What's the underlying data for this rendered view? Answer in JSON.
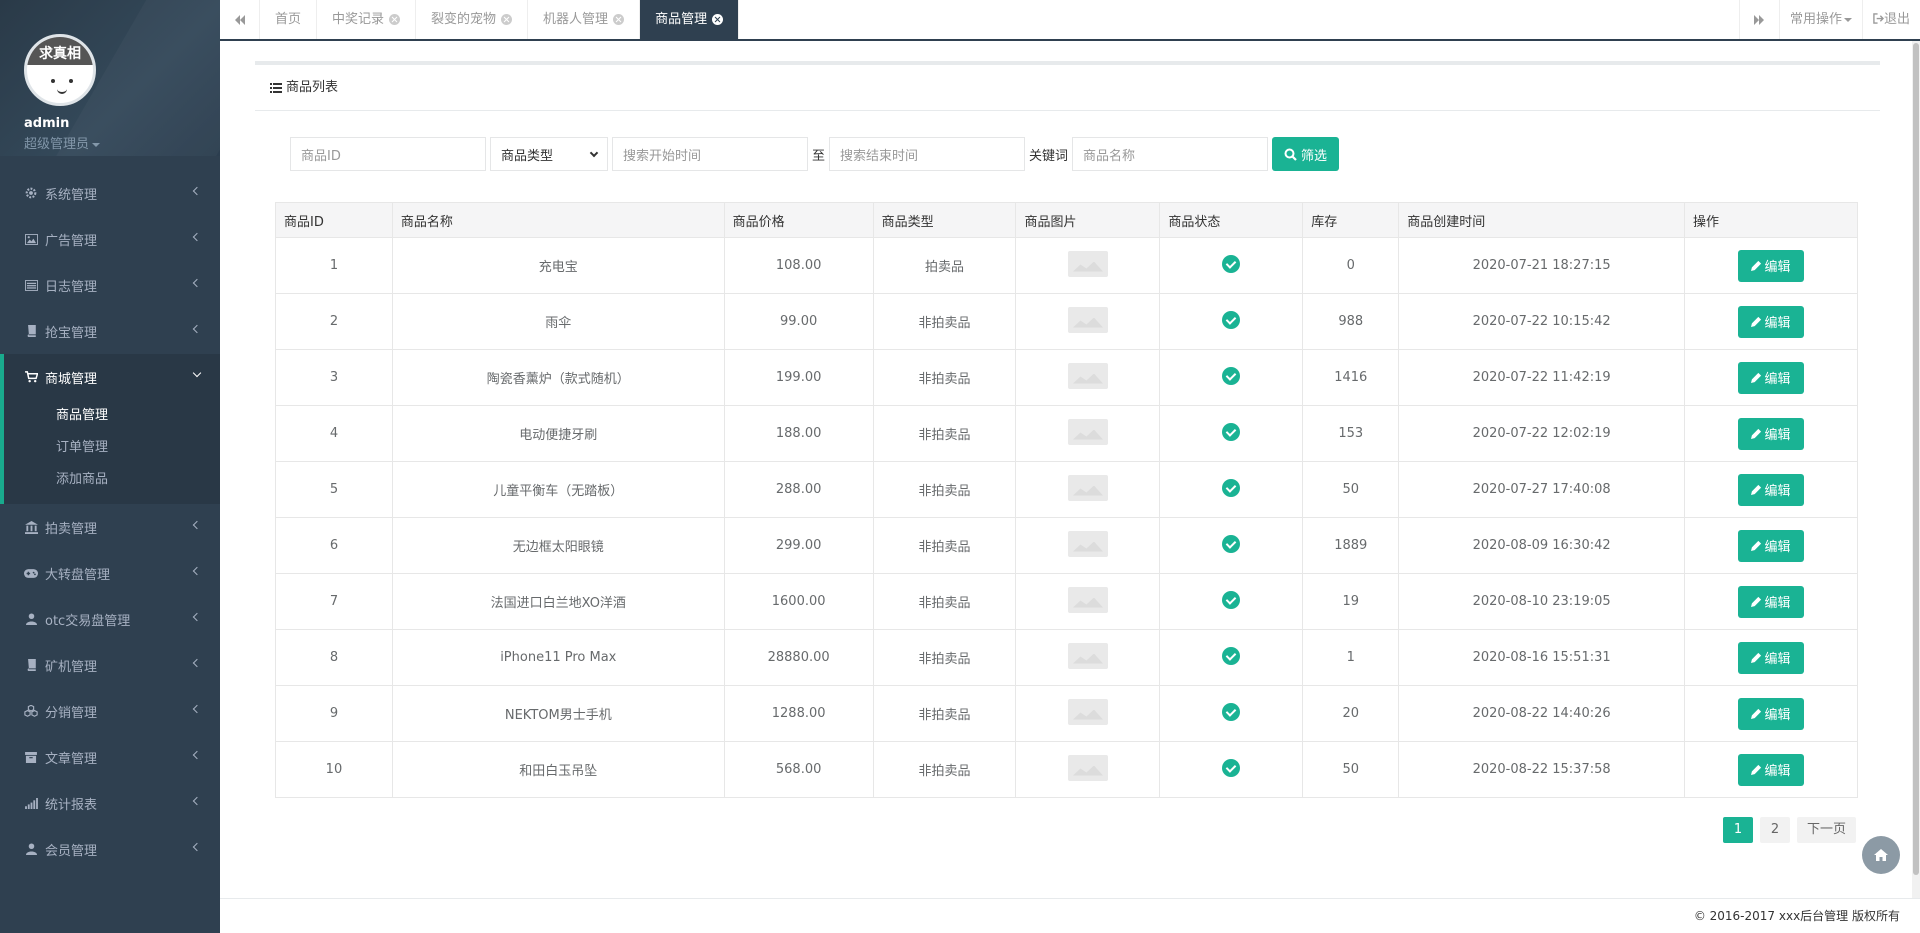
{
  "profile": {
    "avatar_text": "求真相",
    "username": "admin",
    "role": "超级管理员"
  },
  "sidebar": {
    "items_top": [
      {
        "label": "系统管理",
        "icon": "gear-icon"
      },
      {
        "label": "广告管理",
        "icon": "image-icon"
      },
      {
        "label": "日志管理",
        "icon": "list-icon"
      },
      {
        "label": "抢宝管理",
        "icon": "book-icon"
      }
    ],
    "active_group": {
      "label": "商城管理",
      "icon": "cart-icon",
      "children": [
        {
          "label": "商品管理",
          "current": true
        },
        {
          "label": "订单管理",
          "current": false
        },
        {
          "label": "添加商品",
          "current": false
        }
      ]
    },
    "items_bottom": [
      {
        "label": "拍卖管理",
        "icon": "bank-icon"
      },
      {
        "label": "大转盘管理",
        "icon": "gamepad-icon"
      },
      {
        "label": "otc交易盘管理",
        "icon": "user-icon"
      },
      {
        "label": "矿机管理",
        "icon": "book-icon"
      },
      {
        "label": "分销管理",
        "icon": "cubes-icon"
      },
      {
        "label": "文章管理",
        "icon": "archive-icon"
      },
      {
        "label": "统计报表",
        "icon": "signal-icon"
      },
      {
        "label": "会员管理",
        "icon": "user-icon"
      }
    ]
  },
  "topbar": {
    "tabs": [
      {
        "label": "首页",
        "closable": false,
        "active": false
      },
      {
        "label": "中奖记录",
        "closable": true,
        "active": false
      },
      {
        "label": "裂变的宠物",
        "closable": true,
        "active": false
      },
      {
        "label": "机器人管理",
        "closable": true,
        "active": false
      },
      {
        "label": "商品管理",
        "closable": true,
        "active": true
      }
    ],
    "common_ops": "常用操作",
    "logout": "退出"
  },
  "panel": {
    "title": "商品列表"
  },
  "filters": {
    "id_placeholder": "商品ID",
    "type_selected": "商品类型",
    "start_placeholder": "搜索开始时间",
    "to_text": "至",
    "end_placeholder": "搜索结束时间",
    "keyword_label": "关键词",
    "name_placeholder": "商品名称",
    "filter_button": "筛选"
  },
  "table": {
    "columns": [
      "商品ID",
      "商品名称",
      "商品价格",
      "商品类型",
      "商品图片",
      "商品状态",
      "库存",
      "商品创建时间",
      "操作"
    ],
    "edit_label": "编辑",
    "rows": [
      {
        "id": "1",
        "name": "充电宝",
        "price": "108.00",
        "type": "拍卖品",
        "stock": "0",
        "created": "2020-07-21 18:27:15"
      },
      {
        "id": "2",
        "name": "雨伞",
        "price": "99.00",
        "type": "非拍卖品",
        "stock": "988",
        "created": "2020-07-22 10:15:42"
      },
      {
        "id": "3",
        "name": "陶瓷香薰炉（款式随机）",
        "price": "199.00",
        "type": "非拍卖品",
        "stock": "1416",
        "created": "2020-07-22 11:42:19"
      },
      {
        "id": "4",
        "name": "电动便捷牙刷",
        "price": "188.00",
        "type": "非拍卖品",
        "stock": "153",
        "created": "2020-07-22 12:02:19"
      },
      {
        "id": "5",
        "name": "儿童平衡车（无踏板）",
        "price": "288.00",
        "type": "非拍卖品",
        "stock": "50",
        "created": "2020-07-27 17:40:08"
      },
      {
        "id": "6",
        "name": "无边框太阳眼镜",
        "price": "299.00",
        "type": "非拍卖品",
        "stock": "1889",
        "created": "2020-08-09 16:30:42"
      },
      {
        "id": "7",
        "name": "法国进口白兰地XO洋酒",
        "price": "1600.00",
        "type": "非拍卖品",
        "stock": "19",
        "created": "2020-08-10 23:19:05"
      },
      {
        "id": "8",
        "name": "iPhone11 Pro Max",
        "price": "28880.00",
        "type": "非拍卖品",
        "stock": "1",
        "created": "2020-08-16 15:51:31"
      },
      {
        "id": "9",
        "name": "NEKTOM男士手机",
        "price": "1288.00",
        "type": "非拍卖品",
        "stock": "20",
        "created": "2020-08-22 14:40:26"
      },
      {
        "id": "10",
        "name": "和田白玉吊坠",
        "price": "568.00",
        "type": "非拍卖品",
        "stock": "50",
        "created": "2020-08-22 15:37:58"
      }
    ]
  },
  "pager": {
    "pages": [
      "1",
      "2"
    ],
    "current": "1",
    "next": "下一页"
  },
  "footer": "© 2016-2017 xxx后台管理 版权所有",
  "colors": {
    "sidebar": "#2f4050",
    "accent": "#1ab394"
  }
}
